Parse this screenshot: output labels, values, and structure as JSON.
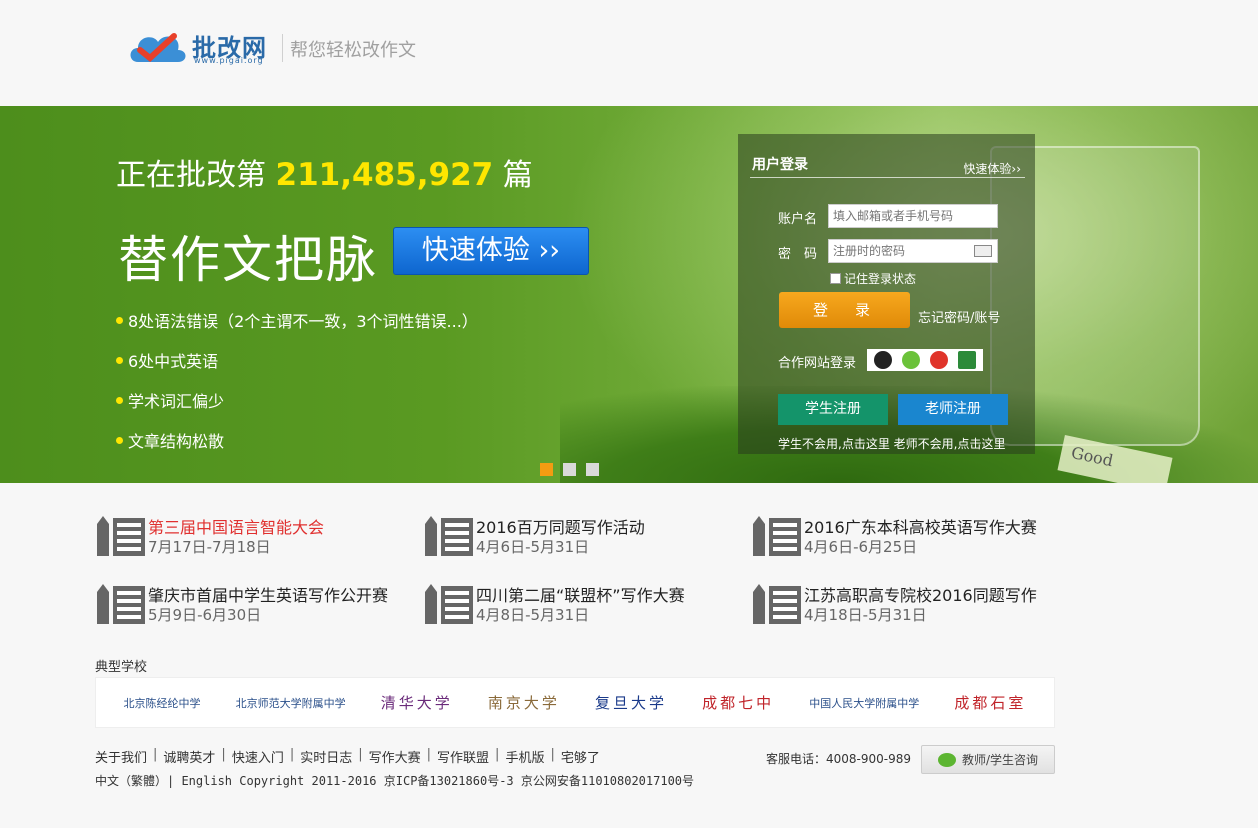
{
  "header": {
    "logo_name": "批改网",
    "logo_url": "www.pigai.org",
    "slogan": "帮您轻松改作文"
  },
  "banner": {
    "counter_prefix": "正在批改第",
    "counter_value": "211,485,927",
    "counter_suffix": "篇",
    "big_title": "替作文把脉",
    "quick_button": "快速体验 ››",
    "bullets": [
      "8处语法错误（2个主谓不一致，3个词性错误...）",
      "6处中式英语",
      "学术词汇偏少",
      "文章结构松散"
    ],
    "tag_text": "Good",
    "slide_count": 3,
    "active_slide": 1
  },
  "login": {
    "title": "用户登录",
    "quick_link": "快速体验››",
    "account_label": "账户名",
    "account_placeholder": "填入邮箱或者手机号码",
    "password_label": "密　码",
    "password_placeholder": "注册时的密码",
    "remember_label": "记住登录状态",
    "login_button": "登　录",
    "forgot_link": "忘记密码/账号",
    "partner_label": "合作网站登录",
    "student_register": "学生注册",
    "teacher_register": "老师注册",
    "register_hint": "学生不会用,点击这里 老师不会用,点击这里"
  },
  "news": [
    {
      "title": "第三届中国语言智能大会",
      "date": "7月17日-7月18日",
      "highlight": true
    },
    {
      "title": "2016百万同题写作活动",
      "date": "4月6日-5月31日",
      "highlight": false
    },
    {
      "title": "2016广东本科高校英语写作大赛",
      "date": "4月6日-6月25日",
      "highlight": false
    },
    {
      "title": "肇庆市首届中学生英语写作公开赛",
      "date": "5月9日-6月30日",
      "highlight": false
    },
    {
      "title": "四川第二届“联盟杯”写作大赛",
      "date": "4月8日-5月31日",
      "highlight": false
    },
    {
      "title": "江苏高职高专院校2016同题写作",
      "date": "4月18日-5月31日",
      "highlight": false
    }
  ],
  "schools": {
    "label": "典型学校",
    "items": [
      {
        "name": "北京陈经纶中学",
        "color": "#2a4f8a"
      },
      {
        "name": "北京师范大学附属中学",
        "color": "#2a4f8a"
      },
      {
        "name": "清华大学",
        "color": "#6a2a7a"
      },
      {
        "name": "南京大学",
        "color": "#8a6a3a"
      },
      {
        "name": "复旦大学",
        "color": "#1a3a8a"
      },
      {
        "name": "成都七中",
        "color": "#c0242a"
      },
      {
        "name": "中国人民大学附属中学",
        "color": "#2a4f8a"
      },
      {
        "name": "成都石室",
        "color": "#c0242a"
      }
    ]
  },
  "footer": {
    "links": [
      "关于我们",
      "诚聘英才",
      "快速入门",
      "实时日志",
      "写作大赛",
      "写作联盟",
      "手机版",
      "宅够了"
    ],
    "copyright": "中文（繁體）| English Copyright 2011-2016 京ICP备13021860号-3 京公网安备11010802017100号",
    "hotline": "客服电话：4008-900-989",
    "consult_button": "教师/学生咨询"
  }
}
